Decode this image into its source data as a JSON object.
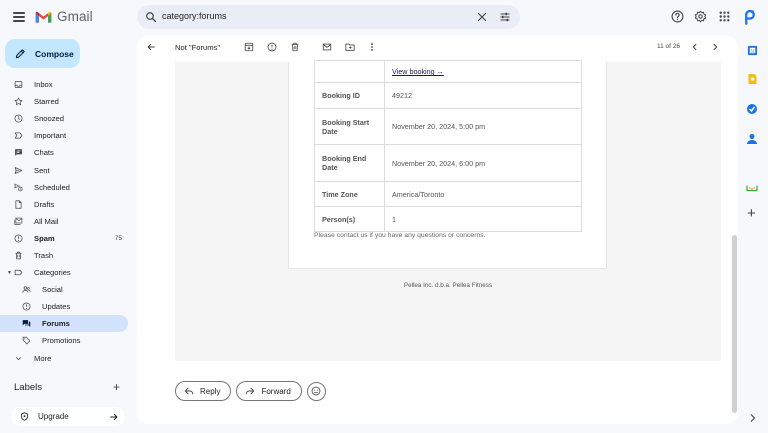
{
  "app": {
    "name": "Gmail",
    "search_query": "category:forums"
  },
  "header_icons": [
    "menu-icon",
    "clear-search-icon",
    "search-options-icon",
    "help-icon",
    "settings-icon",
    "apps-icon",
    "account-avatar-icon"
  ],
  "compose": {
    "label": "Compose"
  },
  "nav": {
    "items": [
      {
        "label": "Inbox",
        "icon": "inbox-icon"
      },
      {
        "label": "Starred",
        "icon": "star-icon"
      },
      {
        "label": "Snoozed",
        "icon": "clock-icon"
      },
      {
        "label": "Important",
        "icon": "important-icon"
      },
      {
        "label": "Chats",
        "icon": "chat-icon"
      },
      {
        "label": "Sent",
        "icon": "send-icon"
      },
      {
        "label": "Scheduled",
        "icon": "scheduled-icon"
      },
      {
        "label": "Drafts",
        "icon": "draft-icon"
      },
      {
        "label": "All Mail",
        "icon": "all-mail-icon"
      },
      {
        "label": "Spam",
        "icon": "spam-icon",
        "count": "75"
      },
      {
        "label": "Trash",
        "icon": "trash-icon"
      },
      {
        "label": "Categories",
        "icon": "label-icon"
      },
      {
        "label": "Social",
        "icon": "social-icon"
      },
      {
        "label": "Updates",
        "icon": "updates-icon"
      },
      {
        "label": "Forums",
        "icon": "forums-icon",
        "active": true
      },
      {
        "label": "Promotions",
        "icon": "promotions-icon"
      },
      {
        "label": "More",
        "icon": "chevron-down-icon"
      }
    ],
    "labels_heading": "Labels",
    "upgrade_label": "Upgrade"
  },
  "toolbar": {
    "label": "Not \"Forums\"",
    "count": "11 of 26"
  },
  "email": {
    "view_link": "View booking →",
    "rows": [
      {
        "key": "Booking ID",
        "value": "49212"
      },
      {
        "key": "Booking Start Date",
        "value": "November 20, 2024, 5:00 pm"
      },
      {
        "key": "Booking End Date",
        "value": "November 20, 2024, 6:00 pm"
      },
      {
        "key": "Time Zone",
        "value": "America/Toronto"
      },
      {
        "key": "Person(s)",
        "value": "1"
      }
    ],
    "contact_text": "Please contact us if you have any questions or concerns.",
    "footer": "Pellea Inc. d.b.a. Pellea Fitness"
  },
  "actions": {
    "reply": "Reply",
    "forward": "Forward"
  },
  "colors": {
    "background": "#f6f8fc",
    "compose": "#c2e7ff",
    "active_nav": "#d3e3fd",
    "search": "#e9eef6"
  }
}
